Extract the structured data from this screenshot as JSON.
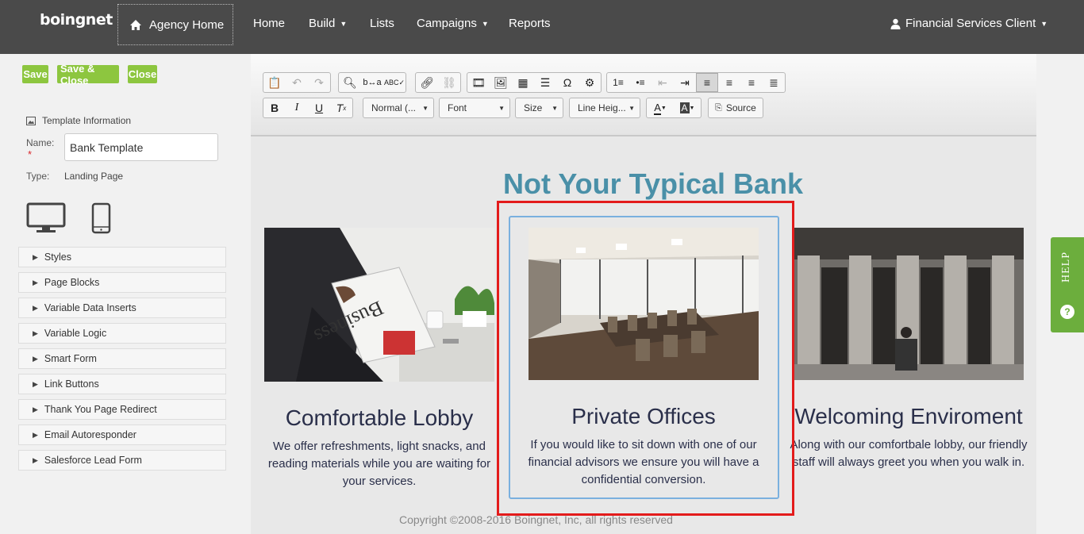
{
  "nav": {
    "logo": "boingnet",
    "agency_home": "Agency Home",
    "items": [
      "Home",
      "Build",
      "Lists",
      "Campaigns",
      "Reports"
    ],
    "account": "Financial Services Client"
  },
  "actions": {
    "save": "Save",
    "save_close": "Save & Close",
    "close": "Close"
  },
  "template_info": {
    "heading": "Template Information",
    "name_label": "Name:",
    "name_value": "Bank Template",
    "type_label": "Type:",
    "type_value": "Landing Page"
  },
  "sections": [
    "Styles",
    "Page Blocks",
    "Variable Data Inserts",
    "Variable Logic",
    "Smart Form",
    "Link Buttons",
    "Thank You Page Redirect",
    "Email Autoresponder",
    "Salesforce Lead Form"
  ],
  "toolbar": {
    "format": "Normal (...",
    "font": "Font",
    "size": "Size",
    "line_height": "Line Heig...",
    "source": "Source"
  },
  "page": {
    "title": "Not Your Typical Bank",
    "cards": [
      {
        "title": "Comfortable Lobby",
        "body": "We offer refreshments, light snacks, and reading materials while you are waiting for your services."
      },
      {
        "title": "Private Offices",
        "body": "If you would like to sit down with one of our financial advisors we ensure you will have a confidential conversion."
      },
      {
        "title": "Welcoming Enviroment",
        "body": "Along with our comfortbale lobby, our friendly staff will always greet you when you walk in."
      }
    ],
    "copyright": "Copyright ©2008-2016 Boingnet, Inc, all rights reserved"
  },
  "help": "HELP",
  "icons": {
    "home": "home-icon",
    "user": "user-icon",
    "desktop": "desktop-icon",
    "mobile": "mobile-icon",
    "help": "help-question-icon"
  }
}
